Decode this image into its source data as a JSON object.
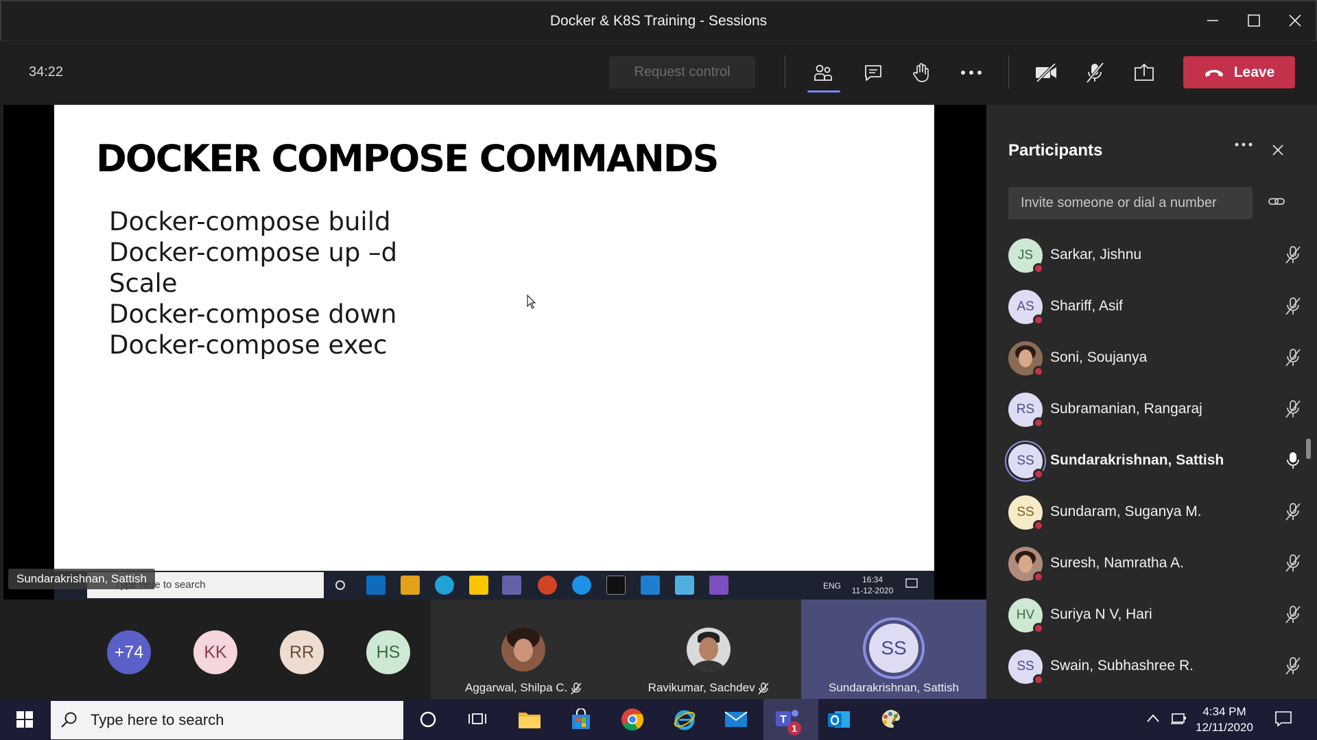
{
  "window": {
    "title": "Docker & K8S Training - Sessions"
  },
  "toolbar": {
    "timer": "34:22",
    "request_control_label": "Request control",
    "leave_label": "Leave",
    "accent": "#7f85f5",
    "leave_color": "#c4314b"
  },
  "slide": {
    "title": "DOCKER COMPOSE COMMANDS",
    "lines": [
      "Docker-compose build",
      "Docker-compose up –d",
      "Scale",
      "Docker-compose down",
      "Docker-compose exec"
    ]
  },
  "shared_taskbar": {
    "search_placeholder": "Type here to search",
    "lang": "ENG",
    "time": "16:34",
    "date": "11-12-2020"
  },
  "presenter_label": "Sundarakrishnan, Sattish",
  "participants_panel": {
    "title": "Participants",
    "invite_placeholder": "Invite someone or dial a number",
    "participants": [
      {
        "initials": "JS",
        "name": "Sarkar, Jishnu",
        "mic": "muted",
        "avatar_bg": "#cde8d3",
        "avatar_fg": "#3a6b45"
      },
      {
        "initials": "AS",
        "name": "Shariff, Asif",
        "mic": "muted",
        "avatar_bg": "#dedcf2",
        "avatar_fg": "#4b4a8a"
      },
      {
        "initials": "",
        "name": "Soni, Soujanya",
        "mic": "muted",
        "avatar_bg": "#8a6b55",
        "avatar_fg": "#ffffff",
        "photo": true
      },
      {
        "initials": "RS",
        "name": "Subramanian, Rangaraj",
        "mic": "muted",
        "avatar_bg": "#dedcf2",
        "avatar_fg": "#4b4a8a"
      },
      {
        "initials": "SS",
        "name": "Sundarakrishnan, Sattish",
        "mic": "on",
        "avatar_bg": "#dedcf2",
        "avatar_fg": "#4b4a8a",
        "speaking": true
      },
      {
        "initials": "SS",
        "name": "Sundaram, Suganya M.",
        "mic": "muted",
        "avatar_bg": "#f5ebc7",
        "avatar_fg": "#7a6220"
      },
      {
        "initials": "",
        "name": "Suresh, Namratha A.",
        "mic": "muted",
        "avatar_bg": "#b08a7a",
        "avatar_fg": "#ffffff",
        "photo": true
      },
      {
        "initials": "HV",
        "name": "Suriya N V, Hari",
        "mic": "muted",
        "avatar_bg": "#cde8d3",
        "avatar_fg": "#3a6b45"
      },
      {
        "initials": "SS",
        "name": "Swain, Subhashree R.",
        "mic": "muted",
        "avatar_bg": "#dedcf2",
        "avatar_fg": "#4b4a8a"
      }
    ]
  },
  "gallery": {
    "overflow": "+74",
    "avatars": [
      {
        "initials": "KK",
        "bg": "#f4d6dc",
        "fg": "#8a3a4a"
      },
      {
        "initials": "RR",
        "bg": "#eddcd0",
        "fg": "#6b4a3a"
      },
      {
        "initials": "HS",
        "bg": "#cde8d3",
        "fg": "#3a6b45"
      }
    ],
    "tiles": [
      {
        "name": "Aggarwal, Shilpa C.",
        "muted": true
      },
      {
        "name": "Ravikumar, Sachdev",
        "muted": true
      },
      {
        "name": "Sundarakrishnan, Sattish",
        "initials": "SS",
        "muted": false
      }
    ]
  },
  "taskbar": {
    "search_placeholder": "Type here to search",
    "time": "4:34 PM",
    "date": "12/11/2020",
    "teams_badge": "1"
  }
}
